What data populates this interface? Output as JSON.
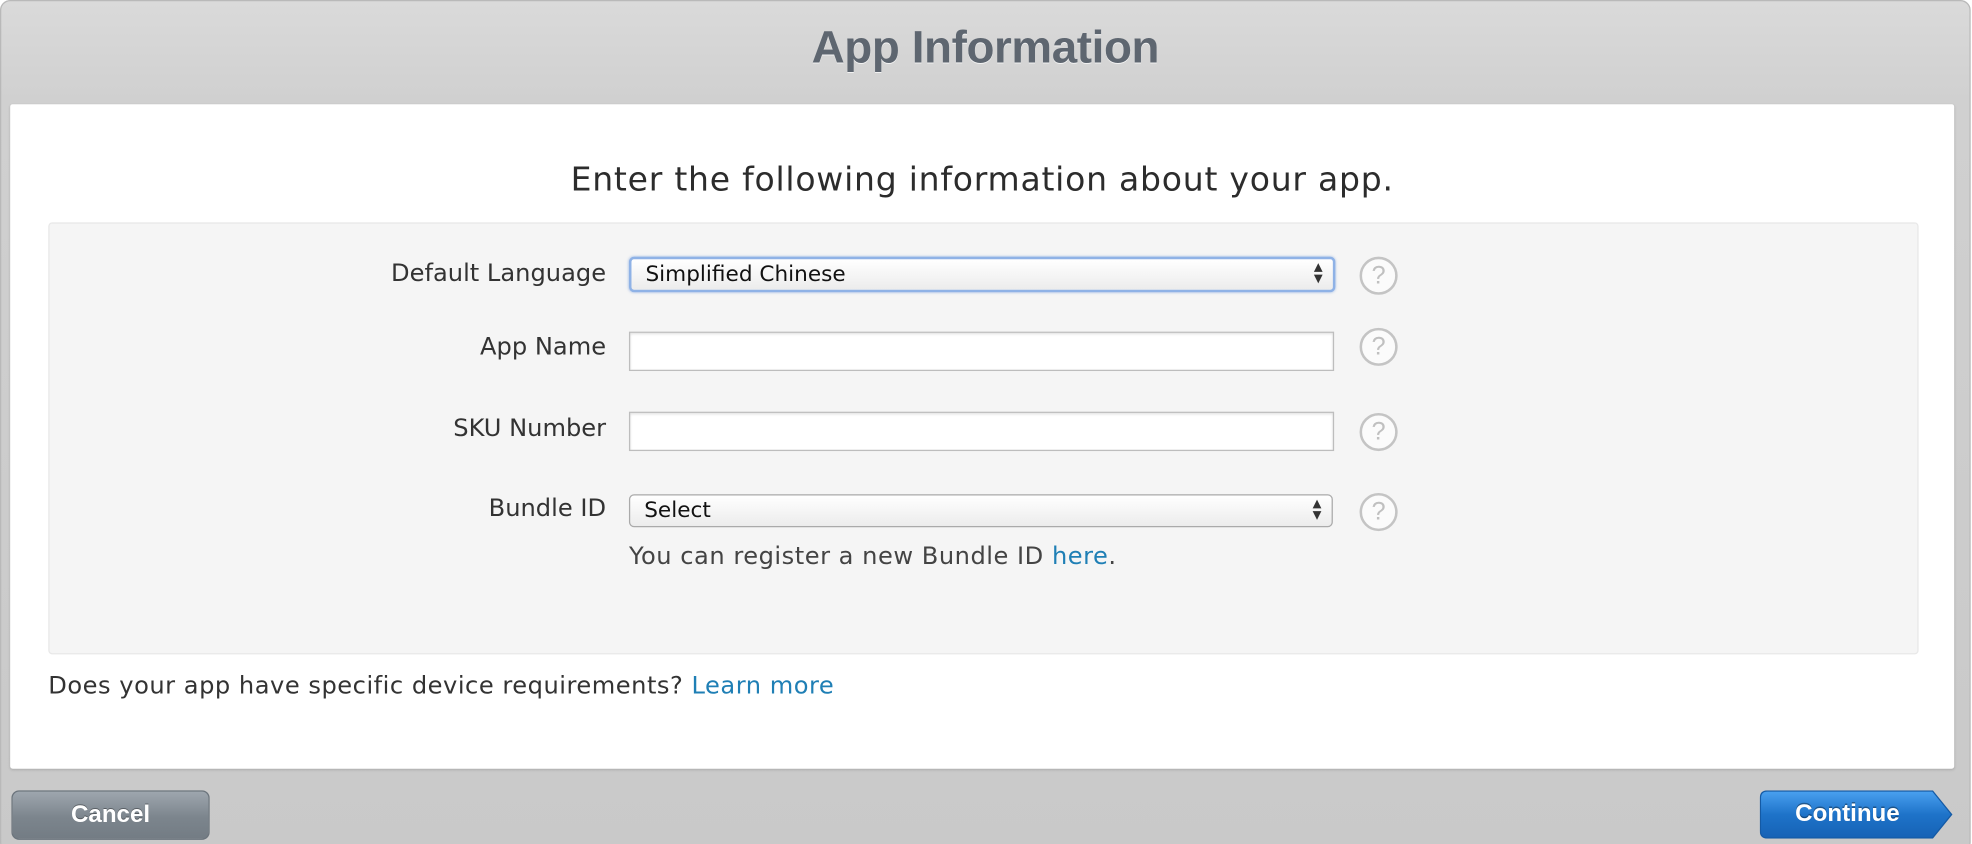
{
  "dialog": {
    "title": "App Information"
  },
  "intro": "Enter the following information about your app.",
  "form": {
    "default_language": {
      "label": "Default Language",
      "value": "Simplified Chinese"
    },
    "app_name": {
      "label": "App Name",
      "value": ""
    },
    "sku_number": {
      "label": "SKU Number",
      "value": ""
    },
    "bundle_id": {
      "label": "Bundle ID",
      "value": "Select"
    },
    "help_glyph": "?",
    "select_arrows": "▲▼",
    "register_hint": {
      "prefix": "You can register a new Bundle ID ",
      "link": "here",
      "suffix": "."
    }
  },
  "device_requirements": {
    "question": "Does your app have specific device requirements? ",
    "link": "Learn more"
  },
  "buttons": {
    "cancel": "Cancel",
    "continue": "Continue"
  },
  "colors": {
    "link": "#1f7fb5",
    "continue_button": "#1e73c9",
    "cancel_button": "#7c858d",
    "title_text": "#5e6670",
    "focus_ring": "#8fb2e6"
  },
  "icons": {
    "help": "question-circle-icon",
    "select": "up-down-chevron-icon"
  }
}
